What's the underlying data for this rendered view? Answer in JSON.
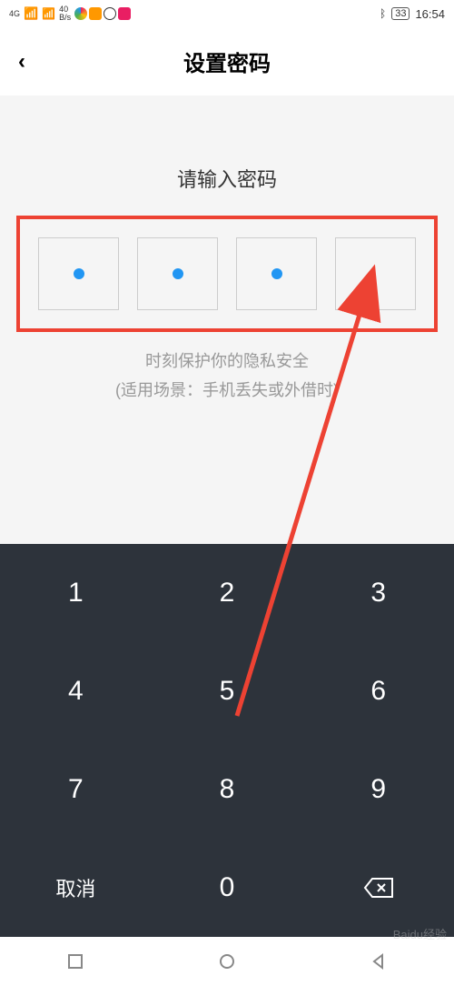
{
  "status_bar": {
    "network_type": "4G",
    "speed_value": "40",
    "speed_unit": "B/s",
    "bluetooth": "✱",
    "battery_level": "33",
    "time": "16:54"
  },
  "nav": {
    "title": "设置密码",
    "back": "‹"
  },
  "content": {
    "prompt": "请输入密码",
    "hint_line1": "时刻保护你的隐私安全",
    "hint_line2": "(适用场景：手机丢失或外借时)",
    "pin_filled": [
      true,
      true,
      true,
      false
    ]
  },
  "keypad": {
    "keys": [
      "1",
      "2",
      "3",
      "4",
      "5",
      "6",
      "7",
      "8",
      "9"
    ],
    "cancel": "取消",
    "zero": "0",
    "backspace": "⌫"
  },
  "annotation": {
    "color": "#ed4233"
  },
  "watermark": "Baidu经验"
}
